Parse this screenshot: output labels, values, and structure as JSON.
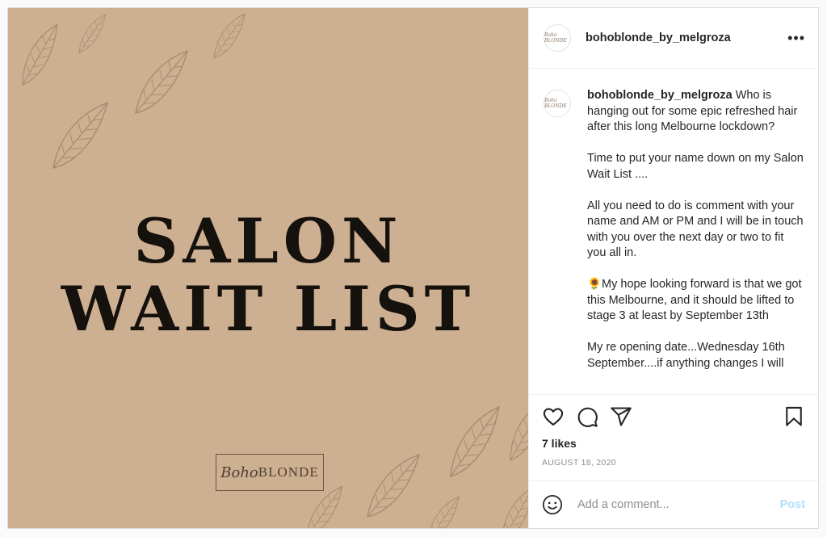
{
  "post": {
    "username": "bohoblonde_by_melgroza",
    "more_icon": "more-horizontal-icon",
    "avatar_text": "Boho BLONDE",
    "image": {
      "title_line1": "SALON",
      "title_line2": "WAIT LIST",
      "logo_script": "Boho",
      "logo_caps": "BLONDE",
      "background_color": "#cdaf92"
    },
    "caption_username": "bohoblonde_by_melgroza",
    "caption_text": " Who is hanging out for some epic refreshed hair after this long Melbourne lockdown?\n\nTime to put your name down on my Salon Wait List ....\n\nAll you need to do is comment with your name and AM or PM and I will be in touch with you over the next day or two to fit you all in.\n\n🌻My hope looking forward is that we got this Melbourne, and it should be lifted to stage 3 at least by September 13th\n\nMy re opening date...Wednesday 16th September....if anything changes I will",
    "likes": "7 likes",
    "date": "AUGUST 18, 2020",
    "comment_placeholder": "Add a comment...",
    "post_label": "Post",
    "post_color": "#b2dffc"
  }
}
